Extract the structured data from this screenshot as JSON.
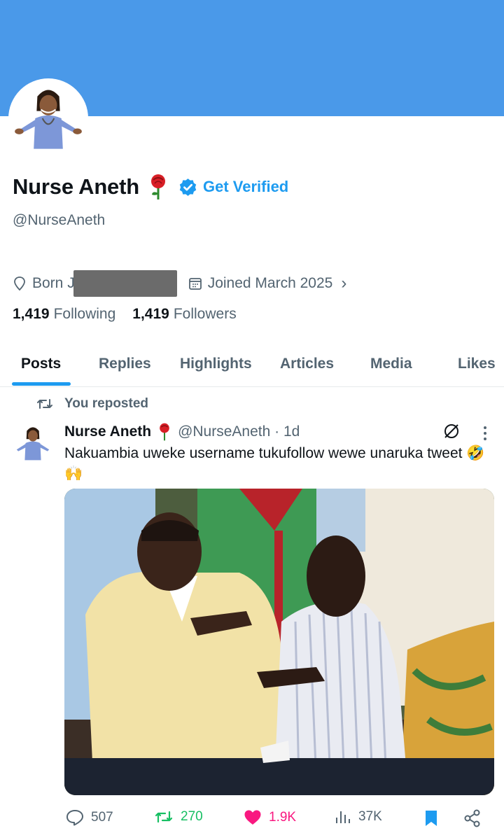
{
  "profile": {
    "name": "Nurse Aneth",
    "get_verified": "Get Verified",
    "handle": "@NurseAneth",
    "born_label": "Born J",
    "joined": "Joined March 2025",
    "following_count": "1,419",
    "following_label": "Following",
    "followers_count": "1,419",
    "followers_label": "Followers"
  },
  "tabs": [
    {
      "label": "Posts",
      "active": true
    },
    {
      "label": "Replies",
      "active": false
    },
    {
      "label": "Highlights",
      "active": false
    },
    {
      "label": "Articles",
      "active": false
    },
    {
      "label": "Media",
      "active": false
    },
    {
      "label": "Likes",
      "active": false
    }
  ],
  "post": {
    "repost_label": "You reposted",
    "author_name": "Nurse Aneth",
    "author_handle": "@NurseAneth · 1d",
    "text": "Nakuambia uweke username tukufollow wewe unaruka tweet 🤣🙌",
    "replies": "507",
    "reposts": "270",
    "likes": "1.9K",
    "views": "37K"
  },
  "colors": {
    "banner": "#4a99e9",
    "accent": "#1d9bf0",
    "repost_green": "#17bf63",
    "like_pink": "#f91880"
  }
}
